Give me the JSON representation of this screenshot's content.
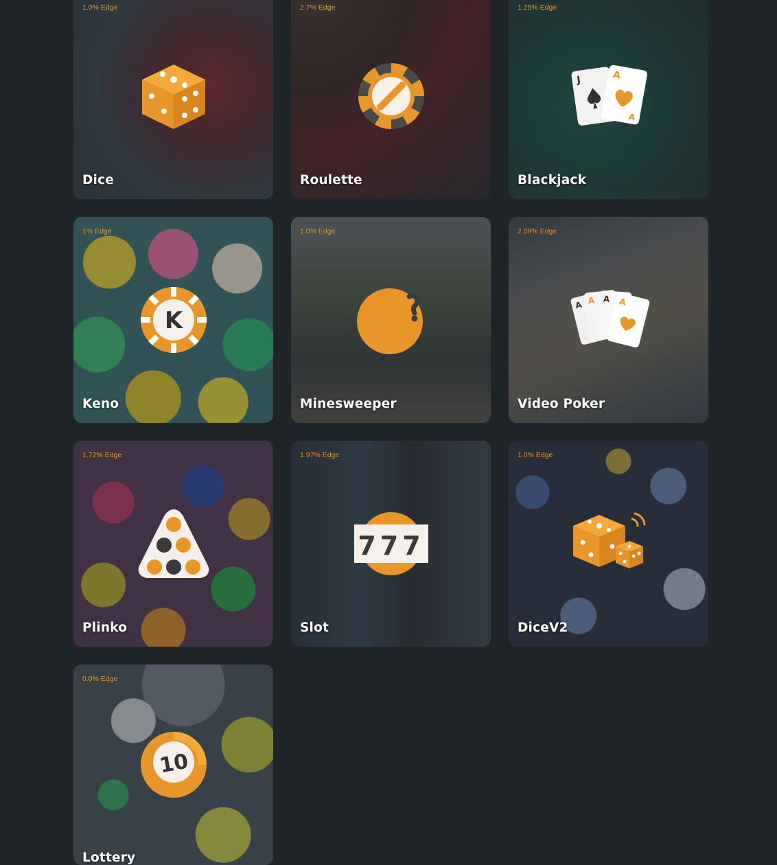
{
  "games": [
    {
      "name": "Dice",
      "edge": "1.0% Edge",
      "icon": "dice-icon"
    },
    {
      "name": "Roulette",
      "edge": "2.7% Edge",
      "icon": "roulette-chip-icon"
    },
    {
      "name": "Blackjack",
      "edge": "1.25% Edge",
      "icon": "blackjack-cards-icon"
    },
    {
      "name": "Keno",
      "edge": "1% Edge",
      "icon": "keno-chip-icon"
    },
    {
      "name": "Minesweeper",
      "edge": "1.0% Edge",
      "icon": "bomb-icon"
    },
    {
      "name": "Video Poker",
      "edge": "2.09% Edge",
      "icon": "poker-cards-icon"
    },
    {
      "name": "Plinko",
      "edge": "1.72% Edge",
      "icon": "plinko-triangle-icon"
    },
    {
      "name": "Slot",
      "edge": "1.97% Edge",
      "icon": "slot-777-icon"
    },
    {
      "name": "DiceV2",
      "edge": "1.0% Edge",
      "icon": "dice-pair-icon"
    },
    {
      "name": "Lottery",
      "edge": "0.0% Edge",
      "icon": "lottery-ball-icon"
    }
  ],
  "lottery_ball_number": "10",
  "slot_digits": "777",
  "keno_letter": "K",
  "colors": {
    "accent": "#e8962a",
    "background": "#1f2428",
    "title_text": "#ffffff"
  }
}
